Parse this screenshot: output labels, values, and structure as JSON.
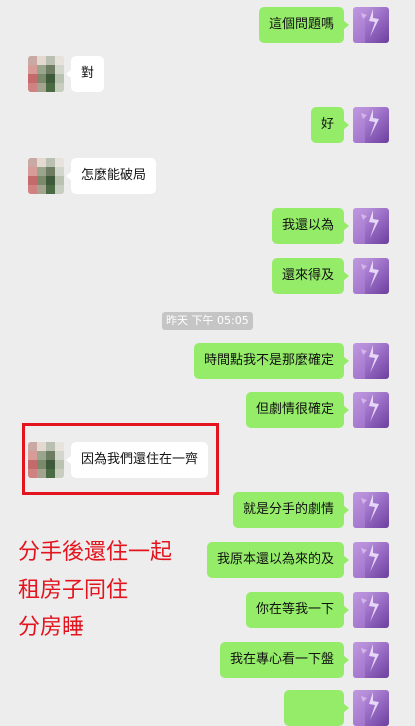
{
  "messages": [
    {
      "side": "me",
      "text": "這個問題嗎"
    },
    {
      "side": "them",
      "text": "對"
    },
    {
      "side": "me",
      "text": "好"
    },
    {
      "side": "them",
      "text": "怎麼能破局"
    },
    {
      "side": "me",
      "text": "我還以為"
    },
    {
      "side": "me",
      "text": "還來得及"
    },
    {
      "side": "me",
      "text": "時間點我不是那麼確定"
    },
    {
      "side": "me",
      "text": "但劇情很確定"
    },
    {
      "side": "them",
      "text": "因為我們還住在一齊"
    },
    {
      "side": "me",
      "text": "就是分手的劇情"
    },
    {
      "side": "me",
      "text": "我原本還以為來的及"
    },
    {
      "side": "me",
      "text": "你在等我一下"
    },
    {
      "side": "me",
      "text": "我在專心看一下盤"
    }
  ],
  "timestamp": "昨天 下午 05:05",
  "annotation": {
    "line1": "分手後還住一起",
    "line2": "租房子同住",
    "line3": "分房睡"
  },
  "colors": {
    "my_bubble": "#95ec69",
    "their_bubble": "#ffffff",
    "background": "#ededed",
    "highlight": "#e3141e"
  },
  "icons": {
    "self_avatar": "purple-lightning-avatar-icon",
    "other_avatar": "pixelated-avatar-icon"
  }
}
